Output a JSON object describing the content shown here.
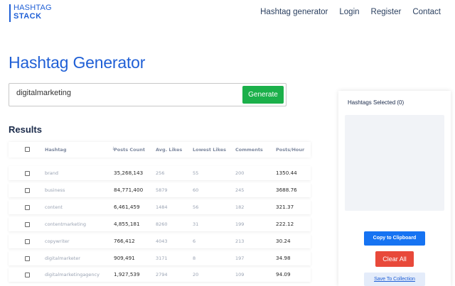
{
  "nav": {
    "logo_line1": "HASHTAG",
    "logo_line2": "STACK",
    "links": [
      "Hashtag generator",
      "Login",
      "Register",
      "Contact"
    ]
  },
  "page_title": "Hashtag Generator",
  "search": {
    "value": "digitalmarketing",
    "button_label": "Generate"
  },
  "results": {
    "heading": "Results",
    "columns": [
      "Hashtag",
      "Posts Count",
      "Avg. Likes",
      "Lowest Likes",
      "Comments",
      "Posts/Hour"
    ],
    "rows": [
      {
        "hashtag": "brand",
        "posts": "35,268,143",
        "avg": "256",
        "low": "55",
        "comments": "200",
        "pph": "1350.44"
      },
      {
        "hashtag": "business",
        "posts": "84,771,400",
        "avg": "5879",
        "low": "60",
        "comments": "245",
        "pph": "3688.76"
      },
      {
        "hashtag": "content",
        "posts": "6,461,459",
        "avg": "1484",
        "low": "56",
        "comments": "182",
        "pph": "321.37"
      },
      {
        "hashtag": "contentmarketing",
        "posts": "4,855,181",
        "avg": "8260",
        "low": "31",
        "comments": "199",
        "pph": "222.12"
      },
      {
        "hashtag": "copywriter",
        "posts": "766,412",
        "avg": "4043",
        "low": "6",
        "comments": "213",
        "pph": "30.24"
      },
      {
        "hashtag": "digitalmarketer",
        "posts": "909,491",
        "avg": "3171",
        "low": "8",
        "comments": "197",
        "pph": "34.98"
      },
      {
        "hashtag": "digitalmarketingagency",
        "posts": "1,927,539",
        "avg": "2794",
        "low": "20",
        "comments": "109",
        "pph": "94.09"
      }
    ]
  },
  "panel": {
    "title": "Hashtags Selected (0)",
    "copy_label": "Copy to Clipboard",
    "clear_label": "Clear All",
    "save_label": "Save To Collection"
  },
  "colors": {
    "brand": "#1f5fd6",
    "generate": "#1bb04a",
    "copy": "#1673f2",
    "clear": "#e8493a"
  }
}
